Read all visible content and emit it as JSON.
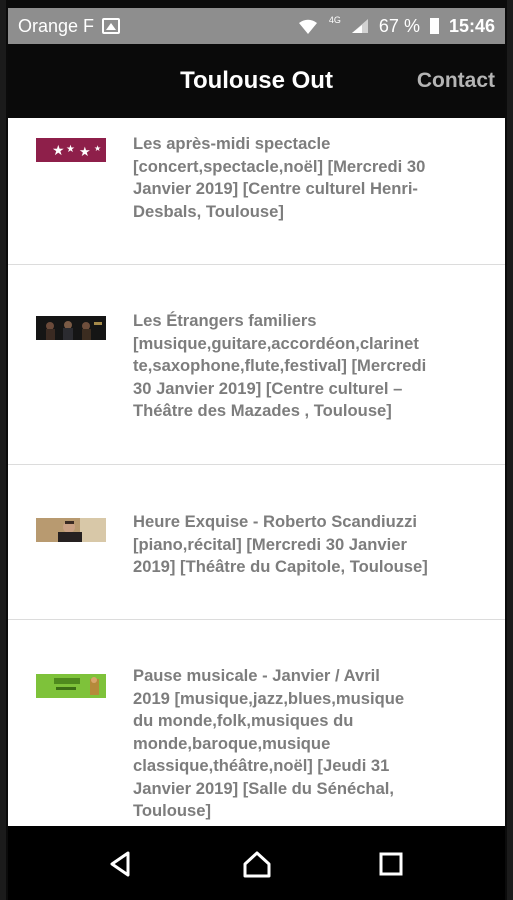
{
  "status_bar": {
    "carrier": "Orange F",
    "network": "4G",
    "battery": "67 %",
    "time": "15:46"
  },
  "app_bar": {
    "title": "Toulouse Out",
    "contact_label": "Contact"
  },
  "events": [
    {
      "thumb_icon": "stars-banner-thumbnail",
      "text": "Les après-midi spectacle\n[concert,spectacle,noël] [Mercredi 30\nJanvier 2019] [Centre culturel Henri-\nDesbals, Toulouse]"
    },
    {
      "thumb_icon": "musicians-photo-thumbnail",
      "text": "Les Étrangers familiers\n[musique,guitare,accordéon,clarinet\nte,saxophone,flute,festival] [Mercredi\n30 Janvier 2019] [Centre culturel –\nThéâtre des Mazades , Toulouse]"
    },
    {
      "thumb_icon": "singer-photo-thumbnail",
      "text": "Heure Exquise - Roberto Scandiuzzi\n[piano,récital] [Mercredi 30 Janvier\n2019] [Théâtre du Capitole, Toulouse]"
    },
    {
      "thumb_icon": "green-poster-thumbnail",
      "text": "Pause musicale - Janvier / Avril\n2019 [musique,jazz,blues,musique\ndu monde,folk,musiques du\nmonde,baroque,musique\nclassique,théâtre,noël] [Jeudi 31\nJanvier 2019] [Salle du Sénéchal,\nToulouse]"
    }
  ],
  "colors": {
    "status_bar_bg": "#8e8e8e",
    "app_bar_bg": "#0a0a0a",
    "list_bg": "#ffffff",
    "event_text": "#7d7d7d",
    "contact_text": "#b4b4b4"
  },
  "nav_icons": [
    "back-icon",
    "home-icon",
    "recents-icon"
  ]
}
